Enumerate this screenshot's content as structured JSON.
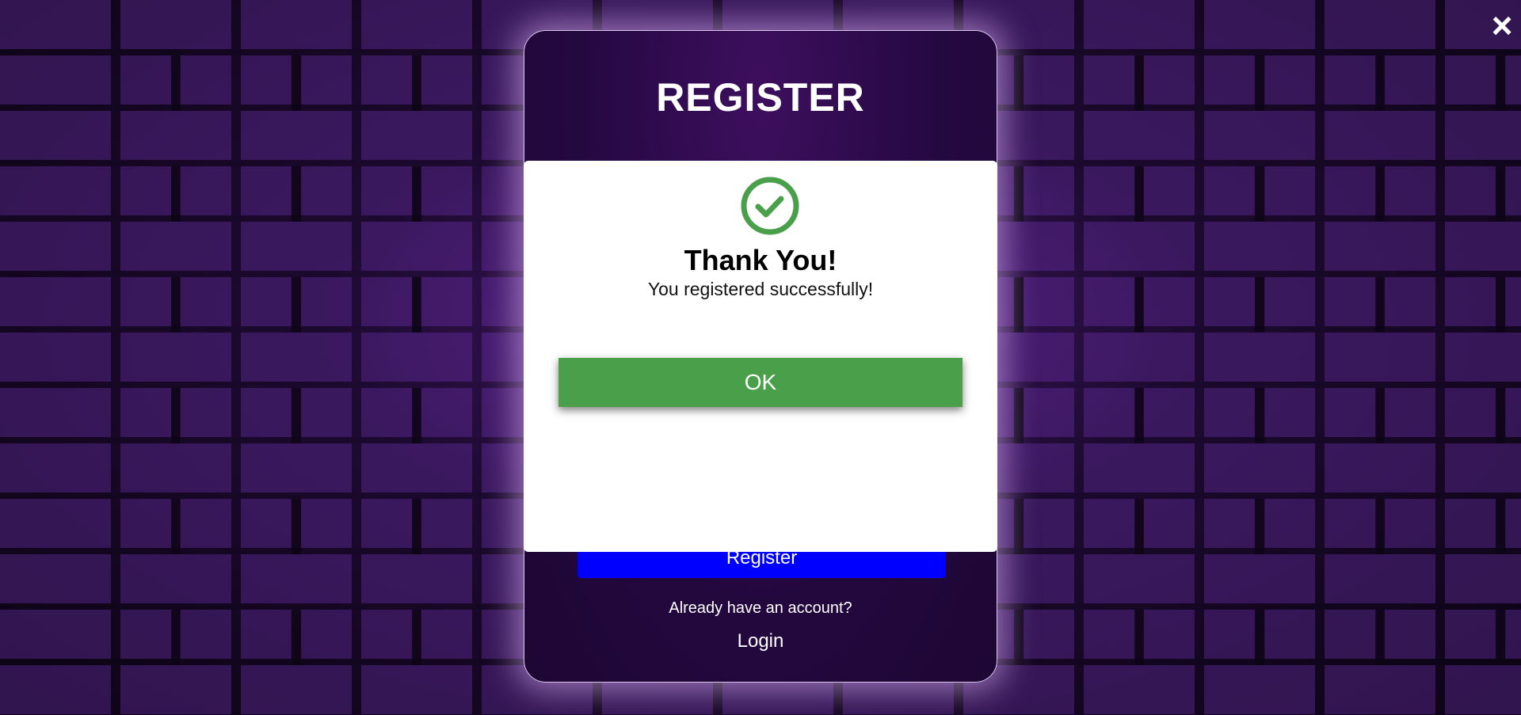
{
  "close_label": "×",
  "card": {
    "title": "REGISTER",
    "register_label": "Register",
    "already_text": "Already have an account?",
    "login_label": "Login"
  },
  "modal": {
    "icon": "check-circle-icon",
    "title": "Thank You!",
    "message": "You registered successfully!",
    "ok_label": "OK"
  },
  "colors": {
    "accent_green": "#4aa04a",
    "register_blue": "#0000ff",
    "card_purple": "#2a0a45"
  }
}
